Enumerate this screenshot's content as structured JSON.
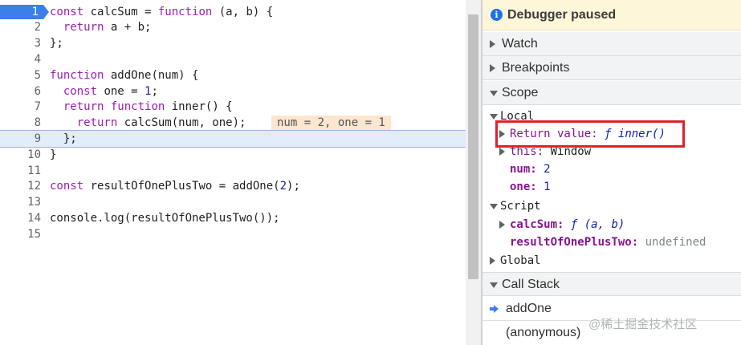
{
  "editor": {
    "lines": [
      {
        "n": "1",
        "text": "const calcSum = function (a, b) {"
      },
      {
        "n": "2",
        "text": "  return a + b;"
      },
      {
        "n": "3",
        "text": "};"
      },
      {
        "n": "4",
        "text": ""
      },
      {
        "n": "5",
        "text": "function addOne(num) {"
      },
      {
        "n": "6",
        "text": "  const one = 1;"
      },
      {
        "n": "7",
        "text": "  return function inner() {"
      },
      {
        "n": "8",
        "text": "    return calcSum(num, one);"
      },
      {
        "n": "9",
        "text": "  };"
      },
      {
        "n": "10",
        "text": "}"
      },
      {
        "n": "11",
        "text": ""
      },
      {
        "n": "12",
        "text": "const resultOfOnePlusTwo = addOne(2);"
      },
      {
        "n": "13",
        "text": ""
      },
      {
        "n": "14",
        "text": "console.log(resultOfOnePlusTwo());"
      },
      {
        "n": "15",
        "text": ""
      }
    ],
    "execution_line": "1",
    "current_line": "9",
    "inline_value": "num = 2, one = 1"
  },
  "debugger": {
    "banner": "Debugger paused",
    "watch_label": "Watch",
    "breakpoints_label": "Breakpoints",
    "scope_label": "Scope",
    "local_label": "Local",
    "return_value": {
      "name": "Return value:",
      "f": "ƒ",
      "fn": "inner()"
    },
    "this_row": {
      "name": "this:",
      "value": "Window"
    },
    "num_row": {
      "name": "num:",
      "value": "2"
    },
    "one_row": {
      "name": "one:",
      "value": "1"
    },
    "script_label": "Script",
    "calcsum_row": {
      "name": "calcSum:",
      "f": "ƒ",
      "sig": "(a, b)"
    },
    "result_row": {
      "name": "resultOfOnePlusTwo:",
      "value": "undefined"
    },
    "global_label": "Global",
    "call_stack_label": "Call Stack",
    "stack": [
      "addOne",
      "(anonymous)"
    ]
  },
  "watermark": "@稀土掘金技术社区",
  "colors": {
    "accent": "#3c7fe8",
    "highlight_box": "#e0202a",
    "banner_bg": "#fdf6d8",
    "inline_value_bg": "#fbe6d0"
  },
  "icons": {
    "paused": "info-icon",
    "collapsed": "triangle-right-icon",
    "expanded": "triangle-down-icon",
    "current_frame": "arrow-right-icon"
  }
}
